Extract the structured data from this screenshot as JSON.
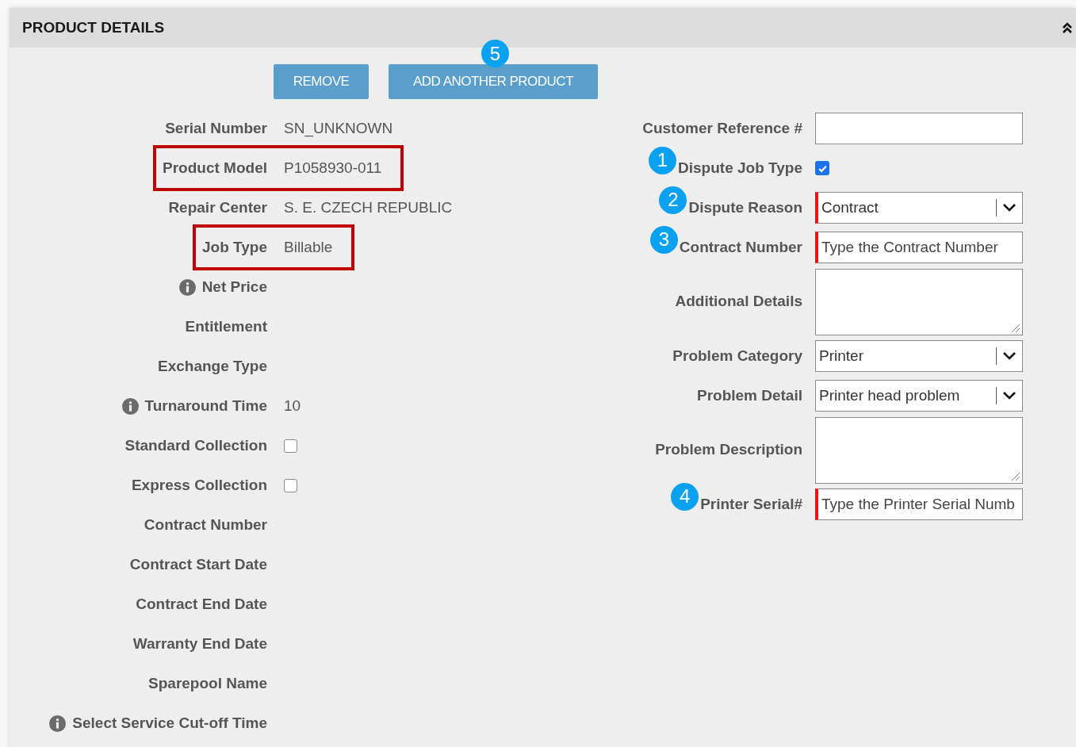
{
  "panel": {
    "title": "PRODUCT DETAILS"
  },
  "buttons": [
    {
      "label": "REMOVE"
    },
    {
      "label": "ADD ANOTHER PRODUCT"
    }
  ],
  "buttons_callout": "5",
  "left_fields": [
    {
      "label": "Serial Number",
      "kind": "text",
      "value": "SN_UNKNOWN",
      "highlighted": false,
      "info": false
    },
    {
      "label": "Product Model",
      "kind": "text",
      "value": "P1058930-011",
      "highlighted": true,
      "info": false
    },
    {
      "label": "Repair Center",
      "kind": "text",
      "value": "S. E. CZECH REPUBLIC",
      "highlighted": false,
      "info": false
    },
    {
      "label": "Job Type",
      "kind": "text",
      "value": "Billable",
      "highlighted": true,
      "info": false
    },
    {
      "label": "Net Price",
      "kind": "empty",
      "highlighted": false,
      "info": true
    },
    {
      "label": "Entitlement",
      "kind": "empty",
      "highlighted": false,
      "info": false
    },
    {
      "label": "Exchange Type",
      "kind": "empty",
      "highlighted": false,
      "info": false
    },
    {
      "label": "Turnaround Time",
      "kind": "text",
      "value": "10",
      "highlighted": false,
      "info": true
    },
    {
      "label": "Standard Collection",
      "kind": "checkbox",
      "checked": false,
      "highlighted": false,
      "info": false
    },
    {
      "label": "Express Collection",
      "kind": "checkbox",
      "checked": false,
      "highlighted": false,
      "info": false
    },
    {
      "label": "Contract Number",
      "kind": "empty",
      "highlighted": false,
      "info": false
    },
    {
      "label": "Contract Start Date",
      "kind": "empty",
      "highlighted": false,
      "info": false
    },
    {
      "label": "Contract End Date",
      "kind": "empty",
      "highlighted": false,
      "info": false
    },
    {
      "label": "Warranty End Date",
      "kind": "empty",
      "highlighted": false,
      "info": false
    },
    {
      "label": "Sparepool Name",
      "kind": "empty",
      "highlighted": false,
      "info": false
    },
    {
      "label": "Select Service Cut-off Time",
      "kind": "empty",
      "highlighted": false,
      "info": true
    }
  ],
  "right_fields": [
    {
      "label": "Customer Reference #",
      "kind": "input",
      "required": false
    },
    {
      "label": "Dispute Job Type",
      "kind": "checkbox",
      "checked": true,
      "callout": "1"
    },
    {
      "label": "Dispute Reason",
      "kind": "select",
      "value": "Contract",
      "required": true,
      "callout": "2"
    },
    {
      "label": "Contract Number",
      "kind": "input",
      "placeholder": "Type the Contract Number",
      "required": true,
      "callout": "3"
    },
    {
      "label": "Additional Details",
      "kind": "textarea",
      "required": false
    },
    {
      "label": "Problem Category",
      "kind": "select",
      "value": "Printer",
      "required": false
    },
    {
      "label": "Problem Detail",
      "kind": "select",
      "value": "Printer head problem",
      "required": false
    },
    {
      "label": "Problem Description",
      "kind": "textarea",
      "required": false
    },
    {
      "label": "Printer Serial#",
      "kind": "input",
      "placeholder": "Type the Printer Serial Numb",
      "required": true,
      "callout": "4"
    }
  ]
}
